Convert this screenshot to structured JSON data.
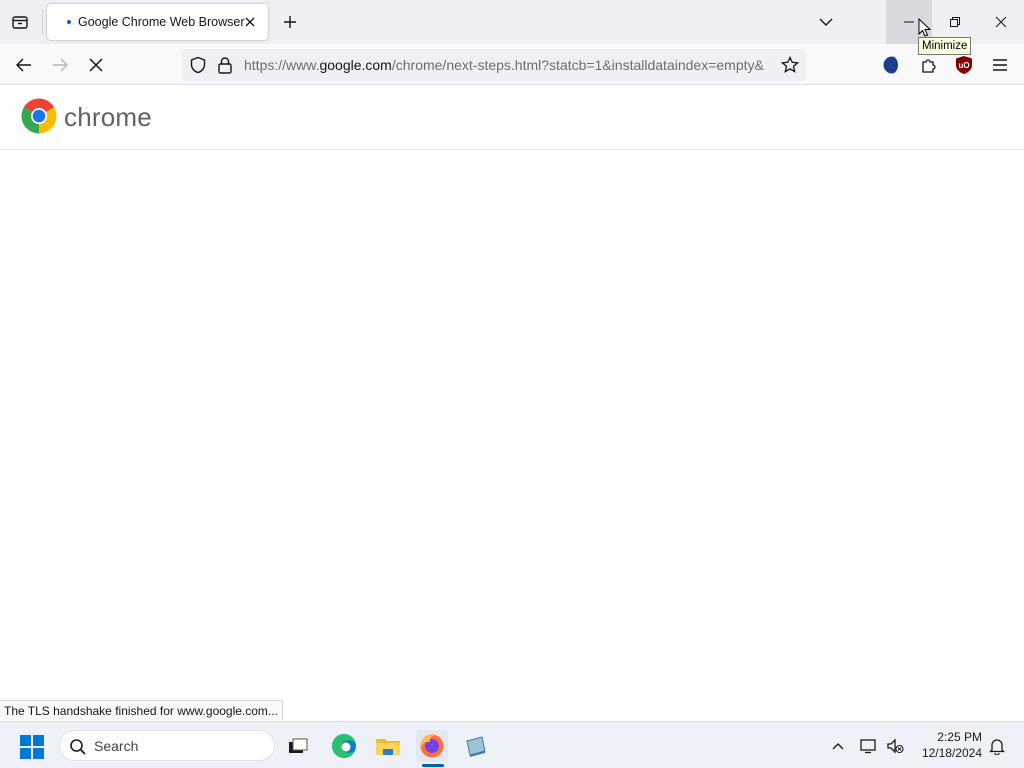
{
  "browser": {
    "tab": {
      "title": "Google Chrome Web Browser"
    },
    "url": {
      "prefix": "https://www.",
      "host": "google.com",
      "path": "/chrome/next-steps.html?statcb=1&installdataindex=empty&"
    },
    "tooltip": "Minimize",
    "status_text": "The TLS handshake finished for www.google.com..."
  },
  "page": {
    "logo_text": "chrome"
  },
  "taskbar": {
    "search_label": "Search",
    "time": "2:25 PM",
    "date": "12/18/2024"
  },
  "icons": {
    "tab_list": "tab-list-icon",
    "close": "close-icon",
    "new_tab": "plus-icon",
    "list_all_tabs": "chevron-down-icon",
    "back": "arrow-left-icon",
    "forward": "arrow-right-icon",
    "stop": "stop-icon",
    "shield": "shield-icon",
    "lock": "lock-icon",
    "bookmark": "star-icon",
    "firefox_account": "account-icon",
    "extensions": "puzzle-icon",
    "ublock": "ublock-icon",
    "menu": "hamburger-icon"
  },
  "colors": {
    "accent": "#0061e0",
    "chrome_red": "#ea4335",
    "chrome_yellow": "#fbbc04",
    "chrome_green": "#34a853",
    "chrome_blue": "#1a73e8"
  }
}
